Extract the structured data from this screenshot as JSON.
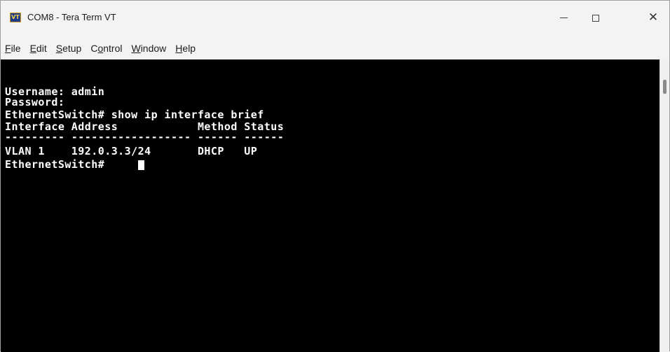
{
  "window": {
    "title": "COM8 - Tera Term VT",
    "app_icon_text": "VT",
    "controls": {
      "minimize": "—",
      "maximize": "□",
      "close": "✕"
    }
  },
  "menu": [
    {
      "pre": "",
      "ul": "F",
      "post": "ile"
    },
    {
      "pre": "",
      "ul": "E",
      "post": "dit"
    },
    {
      "pre": "",
      "ul": "S",
      "post": "etup"
    },
    {
      "pre": "C",
      "ul": "o",
      "post": "ntrol"
    },
    {
      "pre": "",
      "ul": "W",
      "post": "indow"
    },
    {
      "pre": "",
      "ul": "H",
      "post": "elp"
    }
  ],
  "terminal": {
    "lines": [
      "Username: admin",
      "Password:",
      "EthernetSwitch# show ip interface brief",
      "Interface Address            Method Status",
      "--------- ------------------ ------ ------",
      "VLAN 1    192.0.3.3/24       DHCP   UP",
      "EthernetSwitch# "
    ]
  },
  "colors": {
    "terminal_bg": "#000000",
    "terminal_fg": "#ffffff",
    "chrome": "#f3f3f3"
  }
}
